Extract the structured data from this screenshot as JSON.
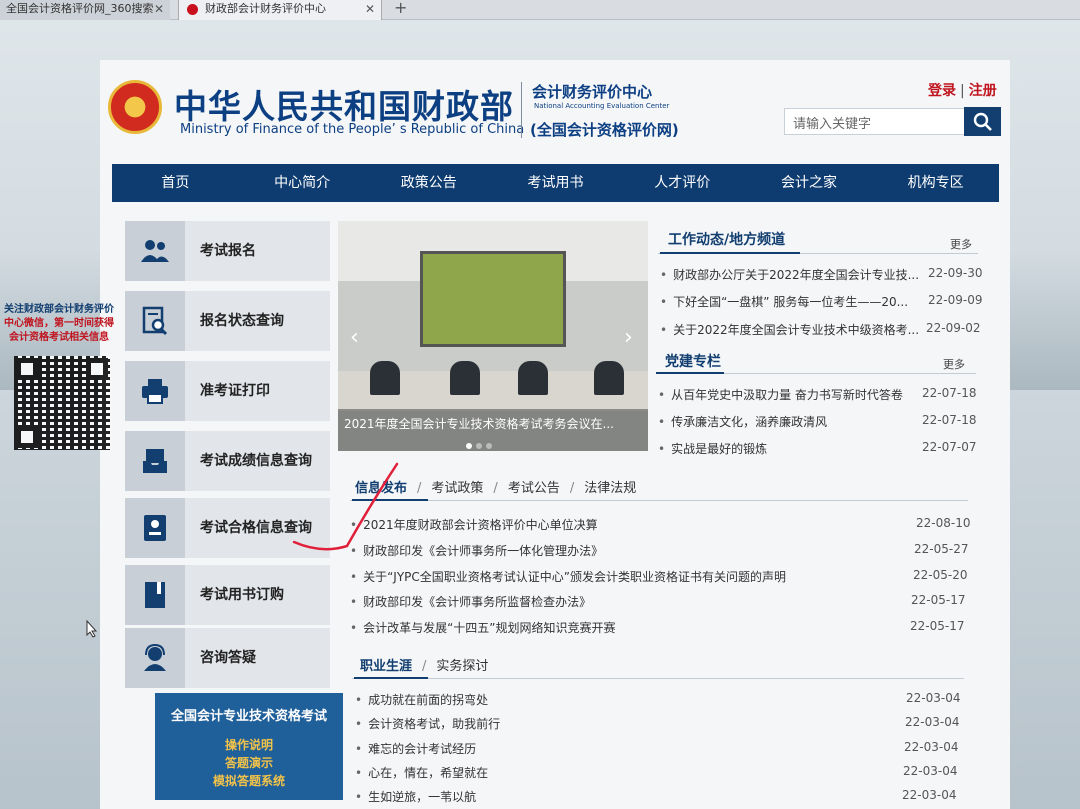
{
  "browser": {
    "tabs": [
      "全国会计资格评价网_360搜索",
      "财政部会计财务评价中心"
    ],
    "new_tab": "+"
  },
  "header": {
    "title_cn": "中华人民共和国财政部",
    "title_en": "Ministry of Finance of the People’ s Republic of China",
    "center_cn": "会计财务评价中心",
    "center_en": "National Accounting Evaluation Center",
    "center_sub": "(全国会计资格评价网)",
    "login": "登录",
    "separator": "|",
    "register": "注册",
    "search_placeholder": "请输入关键字"
  },
  "nav": [
    "首页",
    "中心简介",
    "政策公告",
    "考试用书",
    "人才评价",
    "会计之家",
    "机构专区"
  ],
  "services": [
    {
      "label": "考试报名",
      "icon": "users-icon"
    },
    {
      "label": "报名状态查询",
      "icon": "search-document-icon"
    },
    {
      "label": "准考证打印",
      "icon": "printer-icon"
    },
    {
      "label": "考试成绩信息查询",
      "icon": "inbox-icon"
    },
    {
      "label": "考试合格信息查询",
      "icon": "certificate-icon"
    },
    {
      "label": "考试用书订购",
      "icon": "book-icon"
    },
    {
      "label": "咨询答疑",
      "icon": "headset-icon"
    }
  ],
  "exam_box": {
    "title": "全国会计专业技术资格考试",
    "links": [
      "操作说明",
      "答题演示",
      "模拟答题系统"
    ]
  },
  "qr": {
    "line1": "关注财政部会计财务评价",
    "line2": "中心微信，第一时间获得",
    "line3": "会计资格考试相关信息"
  },
  "slider": {
    "caption": "2021年度全国会计专业技术资格考试考务会议在..."
  },
  "work_news": {
    "title": "工作动态/地方频道",
    "more": "更多",
    "items": [
      {
        "text": "财政部办公厅关于2022年度全国会计专业技...",
        "date": "22-09-30"
      },
      {
        "text": "下好全国“一盘棋” 服务每一位考生——20...",
        "date": "22-09-09"
      },
      {
        "text": "关于2022年度全国会计专业技术中级资格考...",
        "date": "22-09-02"
      }
    ]
  },
  "party_news": {
    "title": "党建专栏",
    "more": "更多",
    "items": [
      {
        "text": "从百年党史中汲取力量 奋力书写新时代答卷",
        "date": "22-07-18"
      },
      {
        "text": "传承廉洁文化，涵养廉政清风",
        "date": "22-07-18"
      },
      {
        "text": "实战是最好的锻炼",
        "date": "22-07-07"
      }
    ]
  },
  "info_tabs": {
    "tabs": [
      "信息发布",
      "考试政策",
      "考试公告",
      "法律法规"
    ],
    "separator": "/",
    "items": [
      {
        "text": "2021年度财政部会计资格评价中心单位决算",
        "date": "22-08-10"
      },
      {
        "text": "财政部印发《会计师事务所一体化管理办法》",
        "date": "22-05-27"
      },
      {
        "text": "关于“JYPC全国职业资格考试认证中心”颁发会计类职业资格证书有关问题的声明",
        "date": "22-05-20"
      },
      {
        "text": "财政部印发《会计师事务所监督检查办法》",
        "date": "22-05-17"
      },
      {
        "text": "会计改革与发展“十四五”规划网络知识竞赛开赛",
        "date": "22-05-17"
      }
    ]
  },
  "career_tabs": {
    "tabs": [
      "职业生涯",
      "实务探讨"
    ],
    "separator": "/",
    "items": [
      {
        "text": "成功就在前面的拐弯处",
        "date": "22-03-04"
      },
      {
        "text": "会计资格考试，助我前行",
        "date": "22-03-04"
      },
      {
        "text": "难忘的会计考试经历",
        "date": "22-03-04"
      },
      {
        "text": "心在，情在，希望就在",
        "date": "22-03-04"
      },
      {
        "text": "生如逆旅，一苇以航",
        "date": "22-03-04"
      }
    ]
  },
  "colors": {
    "brand_blue": "#0f3c70",
    "accent_red": "#c0141f",
    "exam_gold": "#f1c24a"
  }
}
